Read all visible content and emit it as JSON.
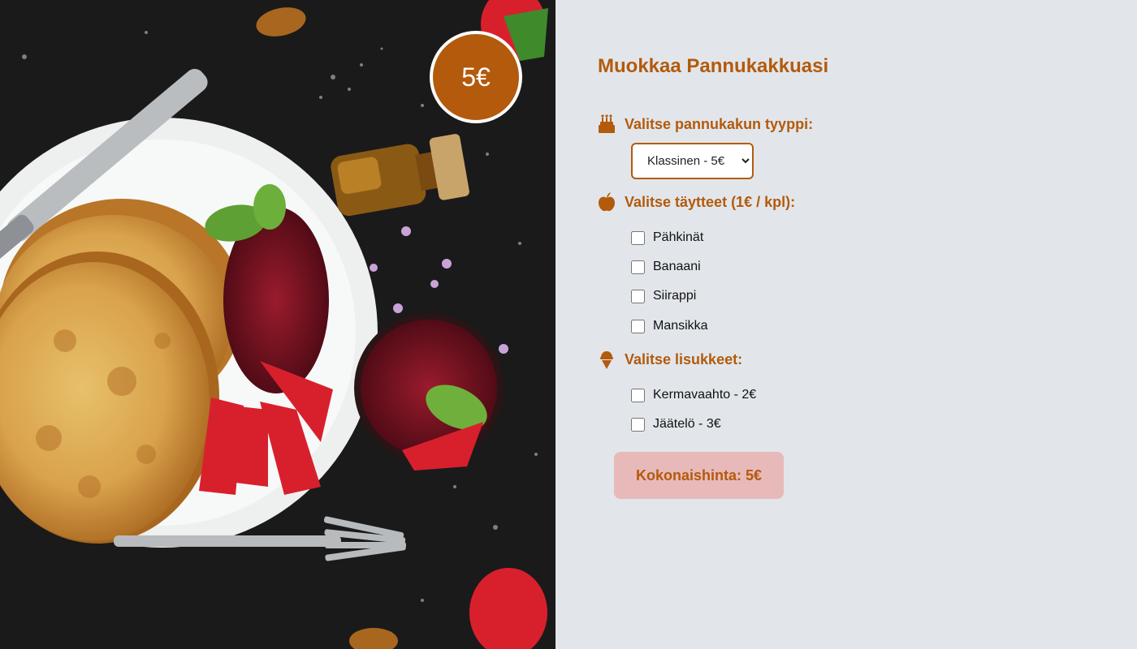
{
  "badge": {
    "price": "5€"
  },
  "form": {
    "title": "Muokkaa Pannukakkuasi",
    "type_section": {
      "label": "Valitse pannukakun tyyppi:",
      "icon": "cake-icon",
      "selected": "Klassinen - 5€"
    },
    "fillings_section": {
      "label": "Valitse täytteet (1€ / kpl):",
      "icon": "apple-icon",
      "options": [
        "Pähkinät",
        "Banaani",
        "Siirappi",
        "Mansikka"
      ]
    },
    "extras_section": {
      "label": "Valitse lisukkeet:",
      "icon": "ice-cream-icon",
      "options": [
        "Kermavaahto - 2€",
        "Jäätelö - 3€"
      ]
    },
    "total": "Kokonaishinta: 5€"
  },
  "colors": {
    "accent": "#b35a0c",
    "panel_bg": "#e2e6eb",
    "total_bg": "#e8b9b9"
  }
}
